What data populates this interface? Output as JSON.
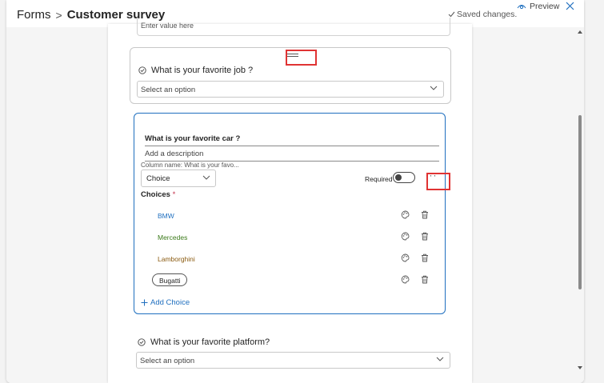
{
  "breadcrumb": {
    "root": "Forms",
    "separator": ">",
    "current": "Customer survey"
  },
  "status": {
    "saved_text": "Saved changes."
  },
  "header": {
    "preview_label": "Preview"
  },
  "top_field": {
    "placeholder": "Enter value here"
  },
  "question_job": {
    "title": "What is your favorite job ?",
    "select_placeholder": "Select an option"
  },
  "question_car": {
    "title": "What is your favorite car ?",
    "description_placeholder": "Add a description",
    "column_name": "Column name: What is your favo...",
    "type": "Choice",
    "required_label": "Required",
    "required": false,
    "choices_label": "Choices",
    "required_star": "*",
    "choices": [
      {
        "label": "BMW",
        "color": "#1f6fbf"
      },
      {
        "label": "Mercedes",
        "color": "#3b7a1a"
      },
      {
        "label": "Lamborghini",
        "color": "#8a5a10"
      },
      {
        "label": "Bugatti",
        "color": "#242424"
      }
    ],
    "add_choice_label": "Add Choice"
  },
  "question_platform": {
    "title": "What is your favorite platform?",
    "select_placeholder": "Select an option"
  },
  "colors": {
    "accent": "#1f6fbf",
    "highlight": "#e03333"
  }
}
